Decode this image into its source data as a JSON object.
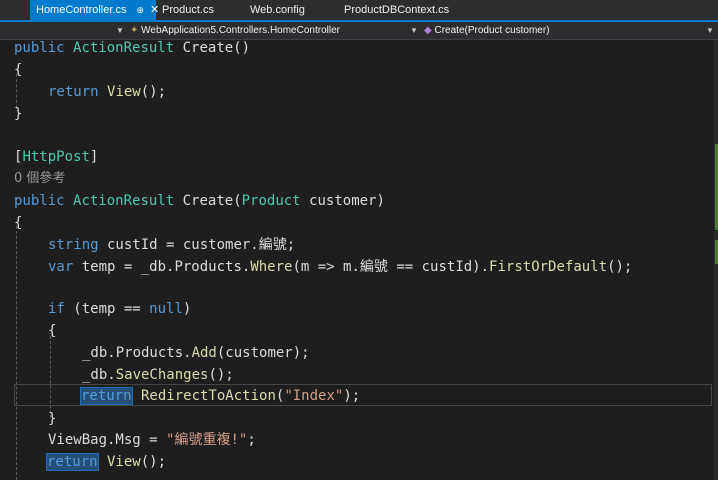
{
  "tabs": [
    {
      "label": "HomeController.cs",
      "pin": "⊕",
      "close": "✕"
    },
    {
      "label": "Product.cs"
    },
    {
      "label": "Web.config"
    },
    {
      "label": "ProductDBContext.cs"
    }
  ],
  "nav": {
    "project": "",
    "class_path": "WebApplication5.Controllers.HomeController",
    "member": "Create(Product customer)"
  },
  "code": {
    "l1": {
      "kw": "public",
      "type": "ActionResult",
      "rest": " Create()"
    },
    "l2": "{",
    "l3": {
      "kw": "return",
      "method": "View",
      "rest": "();"
    },
    "l4": "}",
    "l6": {
      "b1": "[",
      "attr": "HttpPost",
      "b2": "]"
    },
    "l7": "0 個參考",
    "l8": {
      "kw": "public",
      "type": "ActionResult",
      "name": " Create(",
      "ptype": "Product",
      "rest": " customer)"
    },
    "l9": "{",
    "l10": {
      "kw": "string",
      "rest": " custId = customer.編號;"
    },
    "l11": {
      "kw": "var",
      "a": " temp = _db.Products.",
      "m1": "Where",
      "b": "(m => m.編號 == custId).",
      "m2": "FirstOrDefault",
      "c": "();"
    },
    "l13": {
      "kw": "if",
      "a": " (temp == ",
      "kw2": "null",
      "b": ")"
    },
    "l14": "{",
    "l15": {
      "a": "_db.Products.",
      "m": "Add",
      "b": "(customer);"
    },
    "l16": {
      "a": "_db.",
      "m": "SaveChanges",
      "b": "();"
    },
    "l17": {
      "kw": "return",
      "m": " RedirectToAction",
      "a": "(",
      "s": "\"Index\"",
      "b": ");"
    },
    "l18": "}",
    "l19": {
      "a": "ViewBag.Msg = ",
      "s": "\"編號重複!\"",
      "b": ";"
    },
    "l20": {
      "kw": "return",
      "m": " View",
      "b": "();"
    }
  }
}
